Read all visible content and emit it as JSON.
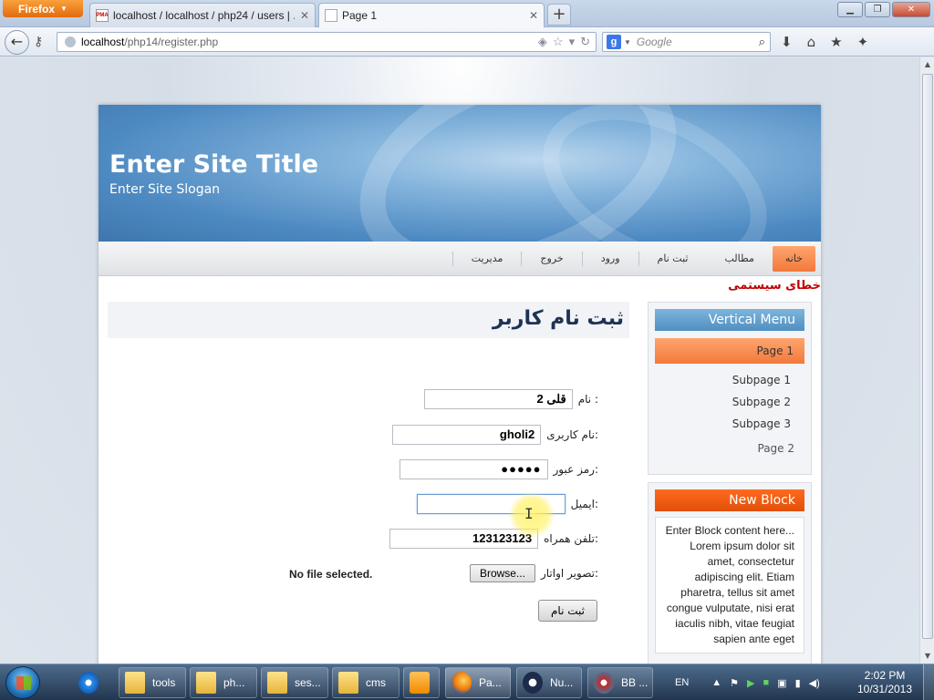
{
  "browser": {
    "app_button": "Firefox",
    "tabs": [
      {
        "label": "localhost / localhost / php24 / users | ...",
        "favicon": "PMA"
      },
      {
        "label": "Page 1"
      }
    ],
    "url_host": "localhost",
    "url_path": "/php14/register.php",
    "search_placeholder": "Google",
    "search_engine_letter": "g"
  },
  "site": {
    "title": "Enter Site Title",
    "slogan": "Enter Site Slogan",
    "menu": [
      "خانه",
      "مطالب",
      "ثبت نام",
      "ورود",
      "خروج",
      "مدیریت"
    ],
    "system_error": "خطای سیستمی",
    "page_title": "ثبت نام کاربر"
  },
  "form": {
    "name_label": "نام :",
    "name_value": "قلی 2",
    "username_label": "نام کاربری:",
    "username_value": "gholi2",
    "password_label": "رمز عبور:",
    "password_value": "●●●●●",
    "email_label": "ایمیل:",
    "email_value": "",
    "phone_label": "تلفن همراه:",
    "phone_value": "123123123",
    "avatar_label": "تصویر اواتار:",
    "browse_label": "Browse...",
    "no_file": "No file selected.",
    "submit_label": "ثبت نام"
  },
  "sidebar": {
    "menu_title": "Vertical Menu",
    "page1": "Page 1",
    "subpages": [
      "Subpage 1",
      "Subpage 2",
      "Subpage 3"
    ],
    "page2": "Page 2",
    "block_title": "New Block",
    "block_content": "Enter Block content here... Lorem ipsum dolor sit amet, consectetur adipiscing elit. Etiam pharetra, tellus sit amet congue vulputate, nisi erat iaculis nibh, vitae feugiat sapien ante eget"
  },
  "taskbar": {
    "items": [
      "tools",
      "ph...",
      "ses...",
      "cms",
      "Pa...",
      "Nu...",
      "BB ..."
    ],
    "language": "EN",
    "time": "2:02 PM",
    "date": "10/31/2013"
  },
  "colors": {
    "accent_orange": "#f2793b",
    "menu_blue": "#4f8fc1",
    "error_red": "#c00000",
    "title_navy": "#1e3354"
  }
}
